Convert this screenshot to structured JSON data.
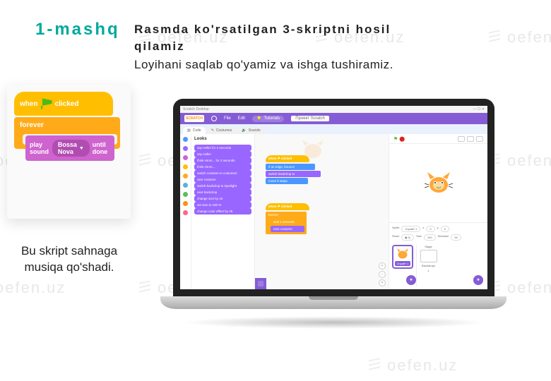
{
  "title": "1-mashq",
  "line1": "Rasmda ko'rsatilgan 3-skriptni hosil qilamiz",
  "line2": "Loyihani saqlab qo'yamiz va ishga tushiramiz.",
  "caption": "Bu skript sahnaga musiqa qo'shadi.",
  "watermark": "oefen.uz",
  "snippet": {
    "hat_prefix": "when",
    "hat_suffix": "clicked",
    "forever": "forever",
    "play_sound": "play sound",
    "sound_name": "Bossa Nova",
    "until_done": "until done"
  },
  "editor": {
    "window_title": "Scratch Desktop",
    "logo": "SCRATCH",
    "menu_file": "File",
    "menu_edit": "Edit",
    "tutorials": "Tutorials",
    "project_name": "Проект Scratch",
    "tab_code": "Code",
    "tab_costumes": "Costumes",
    "tab_sounds": "Sounds",
    "palette_category": "Looks",
    "categories": [
      {
        "name": "Motion",
        "color": "#4C97FF"
      },
      {
        "name": "Looks",
        "color": "#9966FF"
      },
      {
        "name": "Sound",
        "color": "#CF63CF"
      },
      {
        "name": "Events",
        "color": "#FFBF00"
      },
      {
        "name": "Control",
        "color": "#FFAB19"
      },
      {
        "name": "Sensing",
        "color": "#5CB1D6"
      },
      {
        "name": "Operators",
        "color": "#59C059"
      },
      {
        "name": "Variables",
        "color": "#FF8C1A"
      },
      {
        "name": "My Blocks",
        "color": "#FF6680"
      }
    ],
    "palette_blocks": [
      "say Hello! for 2 seconds",
      "say Hello!",
      "think Hmm... for 2 seconds",
      "think Hmm...",
      "switch costume to costume2",
      "next costume",
      "switch backdrop to Spotlight",
      "next backdrop",
      "change size by 10",
      "set size to 100 %",
      "change color effect by 25"
    ],
    "canvas_scripts": {
      "s1_hat": "when ⚑ clicked",
      "s1_b1": "if on edge, bounce",
      "s1_b2": "switch backdrop to",
      "s1_b3": "move 5 steps",
      "s2_hat": "when ⚑ clicked",
      "s2_forever": "forever",
      "s2_wait": "wait 1 seconds",
      "s2_next": "next costume"
    },
    "stage": {
      "sprite_label": "Sprite",
      "sprite_name": "Спрайт 1",
      "x_label": "x",
      "x_val": "0",
      "y_label": "y",
      "y_val": "0",
      "show_label": "Show",
      "size_label": "Size",
      "size_val": "100",
      "dir_label": "Direction",
      "dir_val": "90",
      "stage_label": "Stage",
      "backdrops_label": "Backdrops",
      "backdrops_count": "1"
    }
  }
}
